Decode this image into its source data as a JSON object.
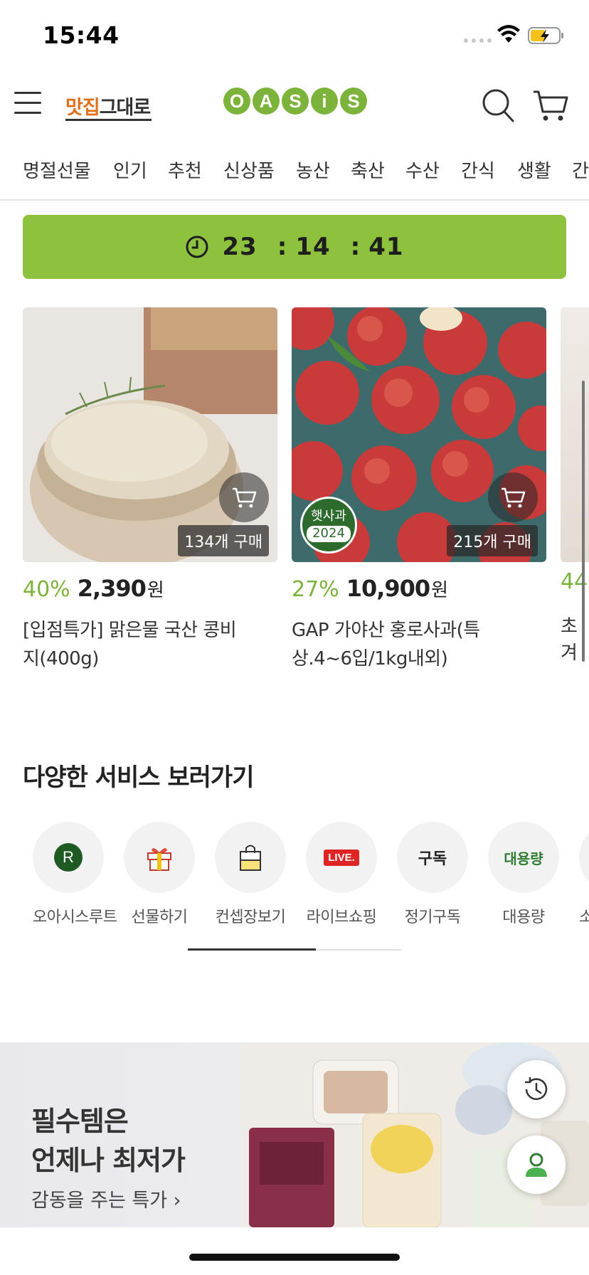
{
  "status_bar": {
    "time": "15:44"
  },
  "header": {
    "brand_left_a": "맛집",
    "brand_left_b": "그대로",
    "logo_letters": [
      "O",
      "A",
      "S",
      "i",
      "S"
    ]
  },
  "categories": [
    "명절선물",
    "인기",
    "추천",
    "신상품",
    "농산",
    "축산",
    "수산",
    "간식",
    "생활",
    "간"
  ],
  "timer": {
    "hours": "23",
    "minutes": "14",
    "seconds": "41",
    "separator": ":"
  },
  "products": [
    {
      "discount": "40%",
      "price": "2,390",
      "currency": "원",
      "name": "[입점특가] 맑은물 국산 콩비지(400g)",
      "name_line1": "[입점특가] 맑은물 국산 콩비",
      "name_line2": "지(400g)",
      "purchases": "134개 구매"
    },
    {
      "discount": "27%",
      "price": "10,900",
      "currency": "원",
      "name": "GAP 가야산 홍로사과(특상.4~6입/1kg내외)",
      "name_line1": "GAP 가야산 홍로사과(특",
      "name_line2": "상.4~6입/1kg내외)",
      "purchases": "215개 구매",
      "badge_line1": "햇사과",
      "badge_line2": "2024"
    },
    {
      "discount": "44",
      "name": "초겨"
    }
  ],
  "services": {
    "title": "다양한 서비스 보러가기",
    "items": [
      {
        "label": "오아시스루트",
        "icon_text": "R"
      },
      {
        "label": "선물하기"
      },
      {
        "label": "컨셉장보기"
      },
      {
        "label": "라이브쇼핑",
        "icon_text": "LIVE."
      },
      {
        "label": "정기구독",
        "icon_text": "구독"
      },
      {
        "label": "대용량",
        "icon_text": "대용량"
      },
      {
        "label": "소"
      }
    ]
  },
  "banner": {
    "line1": "필수템은",
    "line2": "언제나 최저가",
    "sub": "감동을 주는 특가 ›"
  },
  "colors": {
    "accent_green": "#8ec13d",
    "discount_green": "#7bb33b",
    "live_red": "#e02424"
  }
}
